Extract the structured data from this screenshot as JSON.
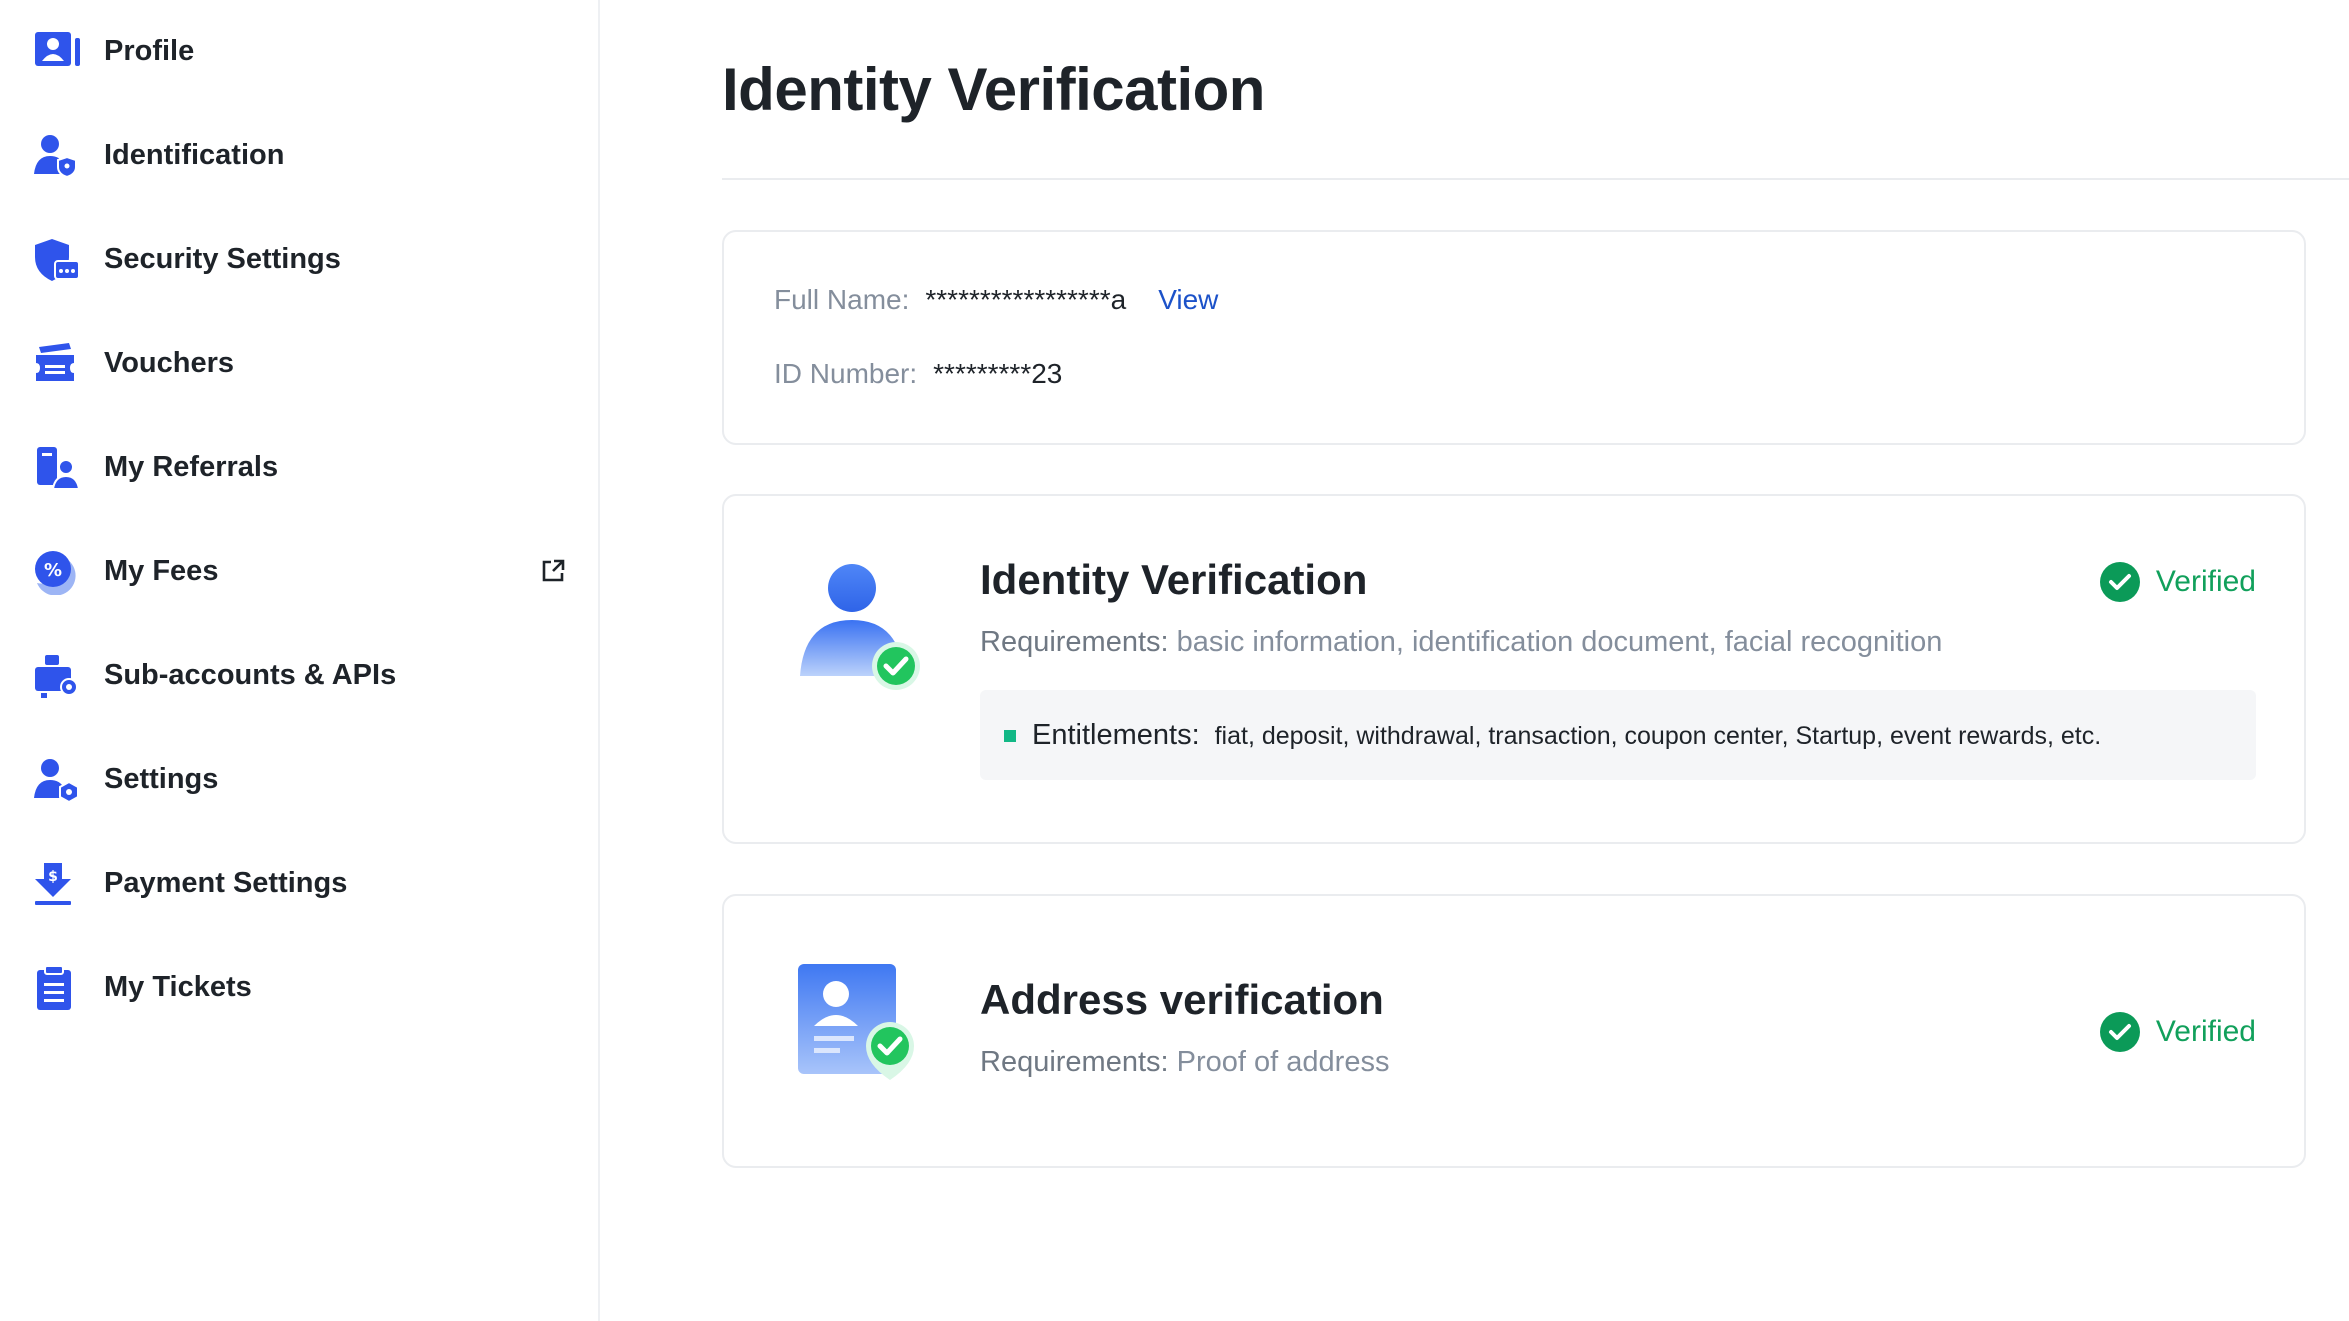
{
  "sidebar": {
    "items": [
      {
        "label": "Profile",
        "icon": "profile-icon"
      },
      {
        "label": "Identification",
        "icon": "identification-icon"
      },
      {
        "label": "Security Settings",
        "icon": "security-shield-icon"
      },
      {
        "label": "Vouchers",
        "icon": "voucher-icon"
      },
      {
        "label": "My Referrals",
        "icon": "referrals-icon"
      },
      {
        "label": "My Fees",
        "icon": "fees-percent-icon"
      },
      {
        "label": "Sub-accounts & APIs",
        "icon": "sub-accounts-icon"
      },
      {
        "label": "Settings",
        "icon": "settings-user-icon"
      },
      {
        "label": "Payment Settings",
        "icon": "payment-download-icon"
      },
      {
        "label": "My Tickets",
        "icon": "tickets-clipboard-icon"
      }
    ],
    "fees_external_icon": "external-link-icon"
  },
  "main": {
    "title": "Identity Verification",
    "info": {
      "full_name_label": "Full Name:",
      "full_name_value": "*****************a",
      "view_label": "View",
      "id_label": "ID Number:",
      "id_value": "*********23"
    },
    "identity": {
      "title": "Identity Verification",
      "req_label": "Requirements:",
      "req_value": "basic information, identification document, facial recognition",
      "status": "Verified",
      "ent_label": "Entitlements:",
      "ent_value": "fiat, deposit, withdrawal, transaction, coupon center, Startup, event rewards, etc."
    },
    "address": {
      "title": "Address verification",
      "req_label": "Requirements:",
      "req_value": "Proof of address",
      "status": "Verified"
    }
  },
  "colors": {
    "accent_blue": "#1c52c9",
    "icon_blue": "#2f54eb",
    "verified_green": "#11a05b",
    "muted_text": "#848e9c"
  }
}
